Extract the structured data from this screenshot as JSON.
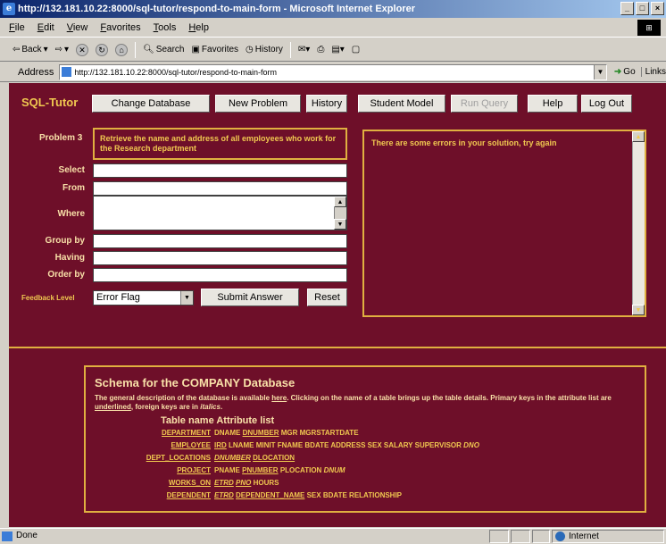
{
  "window": {
    "title": "http://132.181.10.22:8000/sql-tutor/respond-to-main-form - Microsoft Internet Explorer",
    "controls": [
      "_",
      "□",
      "×"
    ]
  },
  "menu": [
    "File",
    "Edit",
    "View",
    "Favorites",
    "Tools",
    "Help"
  ],
  "toolbar": {
    "back": "Back",
    "search": "Search",
    "favorites": "Favorites",
    "history": "History"
  },
  "address": {
    "label": "Address",
    "url": "http://132.181.10.22:8000/sql-tutor/respond-to-main-form",
    "go": "Go",
    "links": "Links"
  },
  "app": {
    "brand": "SQL-Tutor",
    "nav": [
      "Change Database",
      "New Problem",
      "History",
      "Student Model",
      "Run Query",
      "Help",
      "Log Out"
    ]
  },
  "problem": {
    "label": "Problem 3",
    "text": "Retrieve the name and address of all employees who work for the Research department"
  },
  "form": {
    "select": "Select",
    "from": "From",
    "where": "Where",
    "group_by": "Group by",
    "having": "Having",
    "order_by": "Order by",
    "feedback_label": "Feedback Level",
    "feedback_value": "Error Flag",
    "submit": "Submit Answer",
    "reset": "Reset"
  },
  "feedback": {
    "message": "There are some errors in your solution, try again"
  },
  "schema": {
    "title": "Schema for the COMPANY Database",
    "desc_1": "The general description of the database is available ",
    "desc_here": "here",
    "desc_2": ". Clicking on the name of a table brings up the table details. Primary keys in the attribute list are ",
    "desc_underlined": "underlined",
    "desc_3": ", foreign keys are in ",
    "desc_italics": "italics",
    "desc_4": ".",
    "header": "Table name Attribute list",
    "tables": [
      {
        "name": "DEPARTMENT",
        "attrs": [
          {
            "t": "DNAME",
            "k": ""
          },
          {
            "t": "DNUMBER",
            "k": "pk"
          },
          {
            "t": "MGR",
            "k": ""
          },
          {
            "t": "MGRSTARTDATE",
            "k": ""
          }
        ]
      },
      {
        "name": "EMPLOYEE",
        "attrs": [
          {
            "t": "IRD",
            "k": "pk"
          },
          {
            "t": "LNAME",
            "k": ""
          },
          {
            "t": "MINIT",
            "k": ""
          },
          {
            "t": "FNAME",
            "k": ""
          },
          {
            "t": "BDATE",
            "k": ""
          },
          {
            "t": "ADDRESS",
            "k": ""
          },
          {
            "t": "SEX",
            "k": ""
          },
          {
            "t": "SALARY",
            "k": ""
          },
          {
            "t": "SUPERVISOR",
            "k": ""
          },
          {
            "t": "DNO",
            "k": "fk"
          }
        ]
      },
      {
        "name": "DEPT_LOCATIONS",
        "attrs": [
          {
            "t": "DNUMBER",
            "k": "pkfk"
          },
          {
            "t": "DLOCATION",
            "k": "pk"
          }
        ]
      },
      {
        "name": "PROJECT",
        "attrs": [
          {
            "t": "PNAME",
            "k": ""
          },
          {
            "t": "PNUMBER",
            "k": "pk"
          },
          {
            "t": "PLOCATION",
            "k": ""
          },
          {
            "t": "DNUM",
            "k": "fk"
          }
        ]
      },
      {
        "name": "WORKS_ON",
        "attrs": [
          {
            "t": "ETRD",
            "k": "pkfk"
          },
          {
            "t": "PNO",
            "k": "pkfk"
          },
          {
            "t": "HOURS",
            "k": ""
          }
        ]
      },
      {
        "name": "DEPENDENT",
        "attrs": [
          {
            "t": "ETRD",
            "k": "pkfk"
          },
          {
            "t": "DEPENDENT_NAME",
            "k": "pk"
          },
          {
            "t": "SEX",
            "k": ""
          },
          {
            "t": "BDATE",
            "k": ""
          },
          {
            "t": "RELATIONSHIP",
            "k": ""
          }
        ]
      }
    ]
  },
  "status": {
    "left": "Done",
    "zone": "Internet"
  },
  "colors": {
    "page_bg": "#6e0f29",
    "accent": "#e0b040",
    "text": "#f0c850"
  }
}
